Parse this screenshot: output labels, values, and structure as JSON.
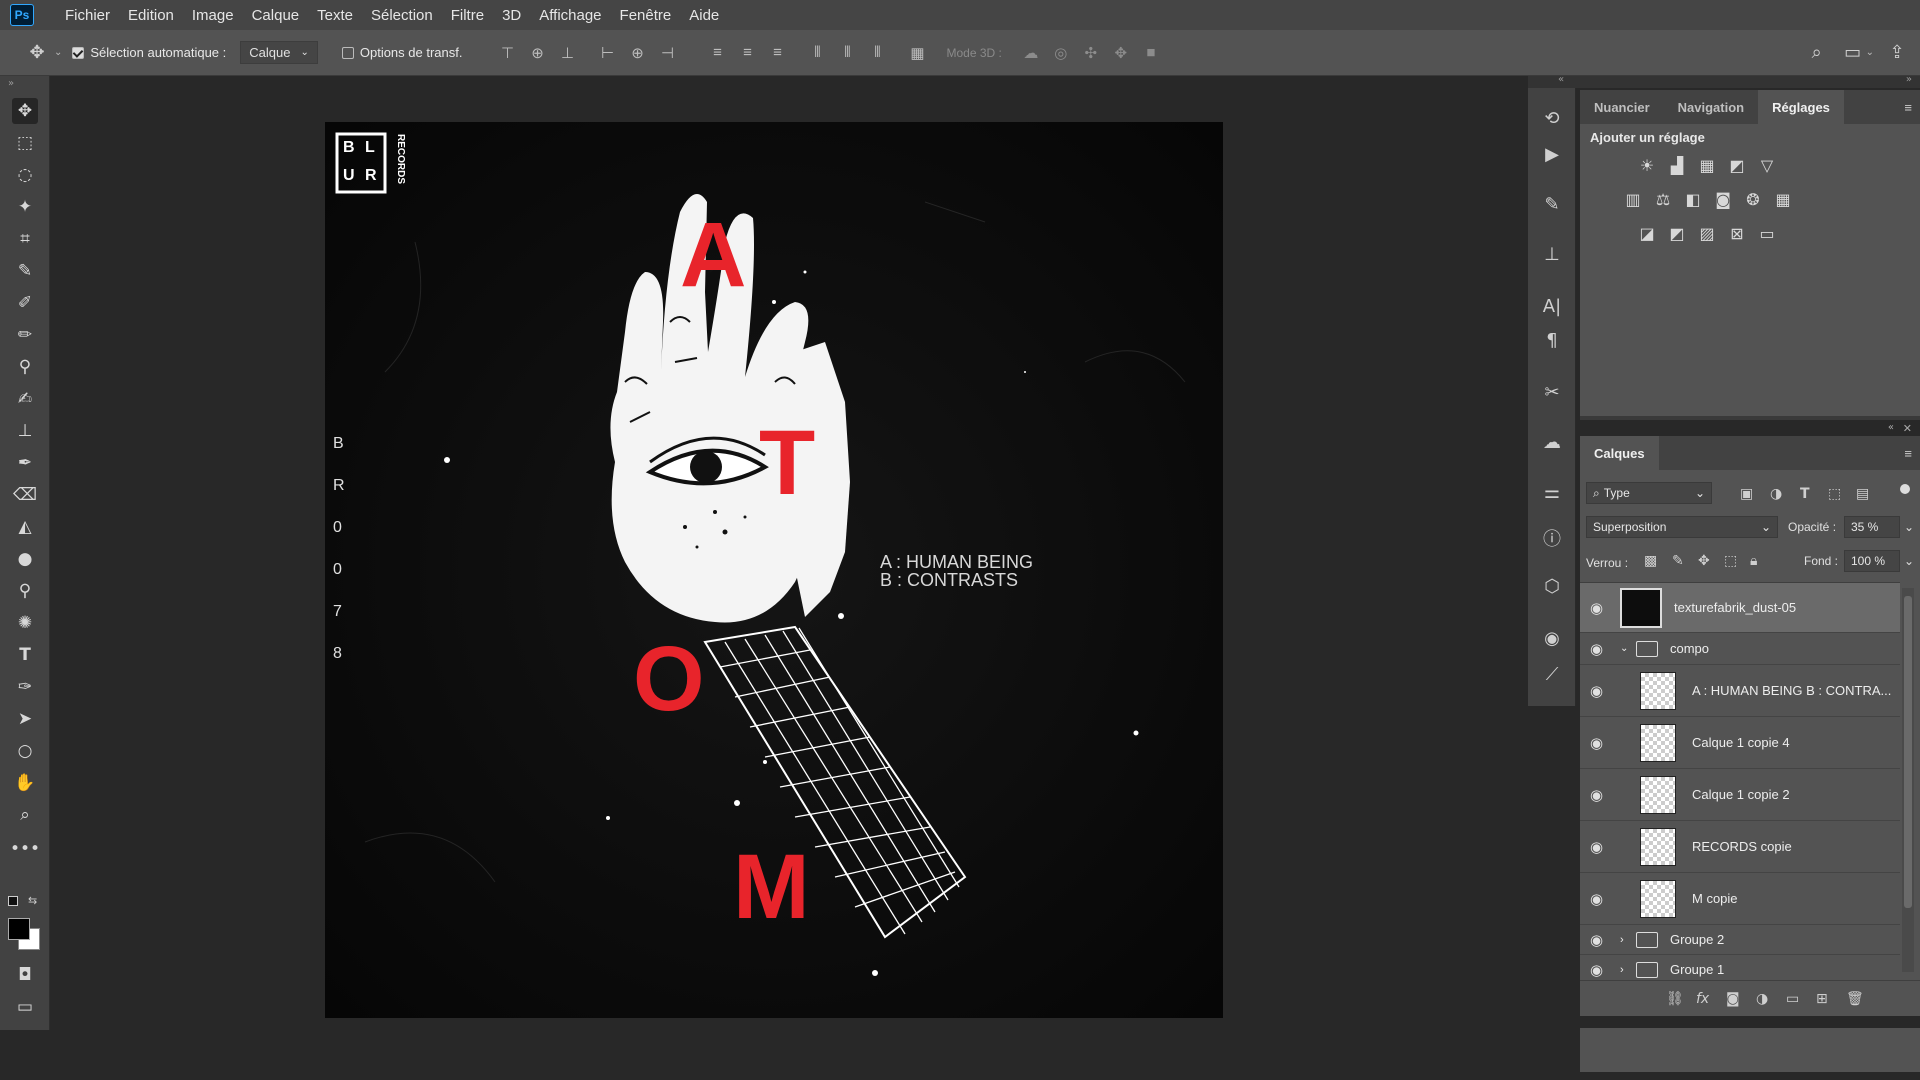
{
  "app": {
    "logo": "Ps"
  },
  "menu": [
    "Fichier",
    "Edition",
    "Image",
    "Calque",
    "Texte",
    "Sélection",
    "Filtre",
    "3D",
    "Affichage",
    "Fenêtre",
    "Aide"
  ],
  "options": {
    "auto_select_label": "Sélection automatique :",
    "auto_select_target": "Calque",
    "transform_label": "Options de transf.",
    "mode3d_label": "Mode 3D :"
  },
  "artwork": {
    "logo_letters": [
      "B",
      "L",
      "U",
      "R"
    ],
    "logo_records": "RECORDS",
    "title_letters": [
      "A",
      "T",
      "O",
      "M"
    ],
    "side_code": [
      "B",
      "R",
      "0",
      "0",
      "7",
      "8"
    ],
    "track_a": "A : HUMAN BEING",
    "track_b": "B : CONTRASTS",
    "accent": "#e8242b"
  },
  "adjustments": {
    "tabs": [
      "Nuancier",
      "Navigation",
      "Réglages"
    ],
    "active_tab": "Réglages",
    "title": "Ajouter un réglage"
  },
  "layers": {
    "tab": "Calques",
    "filter_kind": "Type",
    "blend_mode": "Superposition",
    "opacity_label": "Opacité :",
    "opacity_value": "35 %",
    "lock_label": "Verrou :",
    "fill_label": "Fond :",
    "fill_value": "100 %",
    "items": [
      {
        "name": "texturefabrik_dust-05",
        "kind": "image"
      },
      {
        "name": "compo",
        "kind": "group-open"
      },
      {
        "name": "A : HUMAN BEING B : CONTRA...",
        "kind": "layer"
      },
      {
        "name": "Calque 1 copie 4",
        "kind": "layer"
      },
      {
        "name": "Calque 1 copie 2",
        "kind": "layer"
      },
      {
        "name": "RECORDS copie",
        "kind": "layer"
      },
      {
        "name": "M copie",
        "kind": "layer"
      },
      {
        "name": "Groupe 2",
        "kind": "group-closed"
      },
      {
        "name": "Groupe 1",
        "kind": "group-closed"
      }
    ]
  }
}
